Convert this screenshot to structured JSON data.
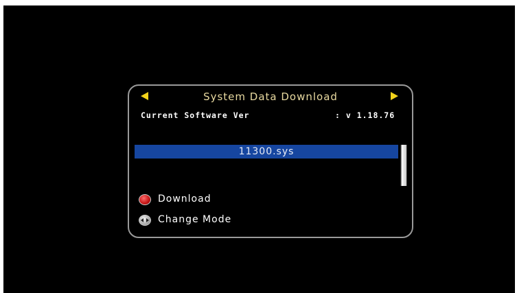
{
  "dialog": {
    "title": "System Data Download",
    "left_arrow_icon": "left-arrow-icon",
    "right_arrow_icon": "right-arrow-icon",
    "accent_color": "#f2d21a"
  },
  "software": {
    "label": "Current Software Ver",
    "value": ": v 1.18.76"
  },
  "file_list": {
    "items": [
      "11300.sys"
    ],
    "selected_color": "#1646a0"
  },
  "actions": [
    {
      "label": "Download",
      "icon": "red-button-icon"
    },
    {
      "label": "Change Mode",
      "icon": "left-right-button-icon"
    }
  ]
}
